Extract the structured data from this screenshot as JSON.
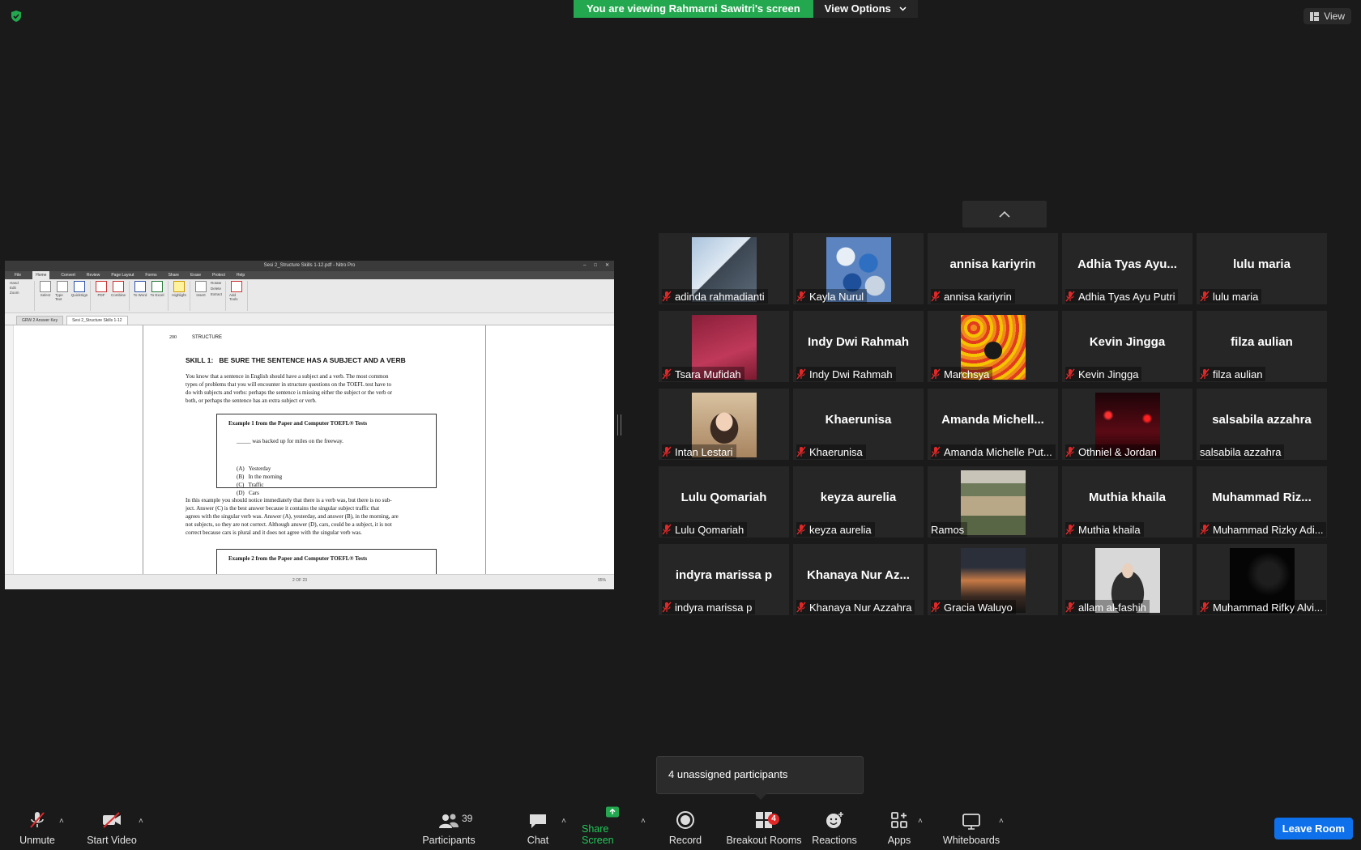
{
  "banner": {
    "viewing": "You are viewing Rahmarni Sawitri's screen",
    "view_options": "View Options"
  },
  "view_button": "View",
  "shared": {
    "window_title": "Sesi 2_Structure Skills 1-12.pdf - Nitro Pro",
    "menu": [
      "File",
      "Home",
      "Convert",
      "Review",
      "Page Layout",
      "Forms",
      "Share",
      "Erase",
      "Protect",
      "Help"
    ],
    "ribbon_left": [
      "Hand",
      "Edit",
      "Zoom"
    ],
    "ribbon_tools": [
      "Select",
      "Type Text",
      "QuickSign",
      "PDF",
      "Combine",
      "To Word",
      "To Excel",
      "Highlight",
      "Insert",
      "Rotate",
      "Delete",
      "Extract",
      "Add Tools"
    ],
    "ribbon_groups": [
      "Tools",
      "Create",
      "Convert",
      "Review",
      "Page Layout",
      "Favorite Tools"
    ],
    "tabs": [
      "GRW 2 Answer Key",
      "Sesi 2_Structure Skills 1-12"
    ],
    "page": {
      "page_no": "200",
      "section": "STRUCTURE",
      "heading": "SKILL 1:   BE SURE THE SENTENCE HAS A SUBJECT AND A VERB",
      "para1": [
        "You know that a sentence in English should have a subject and a verb. The most common",
        "types of problems that you will encounter in structure questions on the TOEFL test have to",
        "do with subjects and verbs: perhaps the sentence is missing either the subject or the verb or",
        "both, or perhaps the sentence has an extra subject or verb."
      ],
      "example1_title": "Example 1 from the Paper and Computer TOEFL® Tests",
      "example1_question": "_____ was backed up for miles on the freeway.",
      "example1_options": [
        "(A)   Yesterday",
        "(B)   In the morning",
        "(C)   Traffic",
        "(D)   Cars"
      ],
      "para2": [
        "In this example you should notice immediately that there is a verb was, but there is no sub-",
        "ject. Answer (C) is the best answer because it contains the singular subject traffic that",
        "agrees with the singular verb was. Answer (A), yesterday, and answer (B), in the morning, are",
        "not subjects, so they are not correct. Although answer (D), cars, could be a subject, it is not",
        "correct because cars is plural and it does not agree with the singular verb was."
      ],
      "example2_title": "Example 2 from the Paper and Computer TOEFL® Tests"
    },
    "status_page": "2 OF 23",
    "status_zoom": "95%"
  },
  "participants": [
    {
      "display": "",
      "caption": "adinda rahmadianti",
      "photo": "building",
      "muted": true
    },
    {
      "display": "",
      "caption": "Kayla Nurul",
      "photo": "balloons",
      "muted": true
    },
    {
      "display": "annisa kariyrin",
      "caption": "annisa kariyrin",
      "muted": true
    },
    {
      "display": "Adhia Tyas Ayu...",
      "caption": "Adhia Tyas Ayu Putri",
      "muted": true
    },
    {
      "display": "lulu maria",
      "caption": "lulu maria",
      "muted": true
    },
    {
      "display": "",
      "caption": "Tsara Mufidah",
      "photo": "red",
      "muted": true
    },
    {
      "display": "Indy Dwi Rahmah",
      "caption": "Indy Dwi Rahmah",
      "muted": true
    },
    {
      "display": "",
      "caption": "Marchsya",
      "photo": "fruit",
      "muted": true
    },
    {
      "display": "Kevin Jingga",
      "caption": "Kevin Jingga",
      "muted": true
    },
    {
      "display": "filza aulian",
      "caption": "filza aulian",
      "muted": true
    },
    {
      "display": "",
      "caption": "Intan Lestari",
      "photo": "person",
      "muted": true
    },
    {
      "display": "Khaerunisa",
      "caption": "Khaerunisa",
      "muted": true
    },
    {
      "display": "Amanda  Michell...",
      "caption": "Amanda Michelle Put...",
      "muted": true
    },
    {
      "display": "",
      "caption": "Othniel & Jordan",
      "photo": "night",
      "muted": true
    },
    {
      "display": "salsabila azzahra",
      "caption": "salsabila azzahra",
      "muted": false
    },
    {
      "display": "Lulu  Qomariah",
      "caption": "Lulu  Qomariah",
      "muted": true
    },
    {
      "display": "keyza aurelia",
      "caption": "keyza aurelia",
      "muted": true
    },
    {
      "display": "",
      "caption": "Ramos",
      "photo": "hammock",
      "muted": false
    },
    {
      "display": "Muthia khaila",
      "caption": "Muthia khaila",
      "muted": true
    },
    {
      "display": "Muhammad  Riz...",
      "caption": "Muhammad Rizky Adi...",
      "muted": true
    },
    {
      "display": "indyra marissa p",
      "caption": "indyra marissa p",
      "muted": true
    },
    {
      "display": "Khanaya Nur Az...",
      "caption": "Khanaya Nur Azzahra",
      "muted": true
    },
    {
      "display": "",
      "caption": "Gracia Waluyo",
      "photo": "sunset",
      "muted": true
    },
    {
      "display": "",
      "caption": "allam al-fashih",
      "photo": "hoodie",
      "muted": true
    },
    {
      "display": "",
      "caption": "Muhammad Rifky Alvi...",
      "photo": "dark",
      "muted": true
    }
  ],
  "toast": "4 unassigned participants",
  "toolbar": {
    "unmute": "Unmute",
    "start_video": "Start Video",
    "participants": "Participants",
    "participants_count": "39",
    "chat": "Chat",
    "share_screen": "Share Screen",
    "record": "Record",
    "breakout_rooms": "Breakout Rooms",
    "breakout_badge": "4",
    "reactions": "Reactions",
    "apps": "Apps",
    "whiteboards": "Whiteboards",
    "leave": "Leave Room"
  },
  "colors": {
    "green": "#23a84f",
    "leave_blue": "#0e71eb",
    "muted_red": "#e02828",
    "bg": "#1a1a1a"
  }
}
